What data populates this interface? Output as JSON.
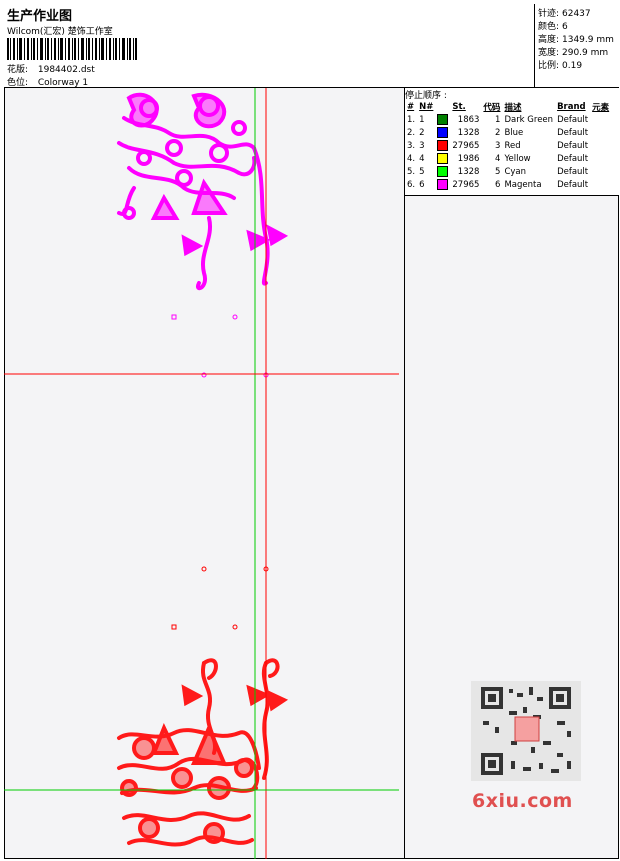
{
  "header": {
    "title": "生产作业图",
    "studio": "Wilcom(汇宏) 楚饰工作室",
    "design_label": "花版:",
    "design_file": "1984402.dst",
    "colorway_label": "色位:",
    "colorway": "Colorway 1"
  },
  "stats": [
    {
      "label": "针迹:",
      "value": "62437"
    },
    {
      "label": "颜色:",
      "value": "6"
    },
    {
      "label": "高度:",
      "value": "1349.9 mm"
    },
    {
      "label": "宽度:",
      "value": "290.9 mm"
    },
    {
      "label": "比例:",
      "value": "0.19"
    }
  ],
  "stop_sequence": {
    "title": "停止顺序 :",
    "columns": [
      "#",
      "N#",
      "St.",
      "代码",
      "描述",
      "Brand",
      "元素"
    ],
    "rows": [
      {
        "idx": "1.",
        "n": "1",
        "color": "#008000",
        "stitches": "1863",
        "code": "1",
        "desc": "Dark Green",
        "brand": "Default"
      },
      {
        "idx": "2.",
        "n": "2",
        "color": "#0000ff",
        "stitches": "1328",
        "code": "2",
        "desc": "Blue",
        "brand": "Default"
      },
      {
        "idx": "3.",
        "n": "3",
        "color": "#ff0000",
        "stitches": "27965",
        "code": "3",
        "desc": "Red",
        "brand": "Default"
      },
      {
        "idx": "4.",
        "n": "4",
        "color": "#ffff00",
        "stitches": "1986",
        "code": "4",
        "desc": "Yellow",
        "brand": "Default"
      },
      {
        "idx": "5.",
        "n": "5",
        "color": "#00ff00",
        "stitches": "1328",
        "code": "5",
        "desc": "Cyan",
        "brand": "Default"
      },
      {
        "idx": "6.",
        "n": "6",
        "color": "#ff00ff",
        "stitches": "27965",
        "code": "6",
        "desc": "Magenta",
        "brand": "Default"
      }
    ]
  },
  "design_colors": {
    "top": "#ff00ff",
    "bottom": "#ff1a1a",
    "guide_green": "#00cc00",
    "guide_red": "#ff0000"
  },
  "watermark": "6xiu.com"
}
